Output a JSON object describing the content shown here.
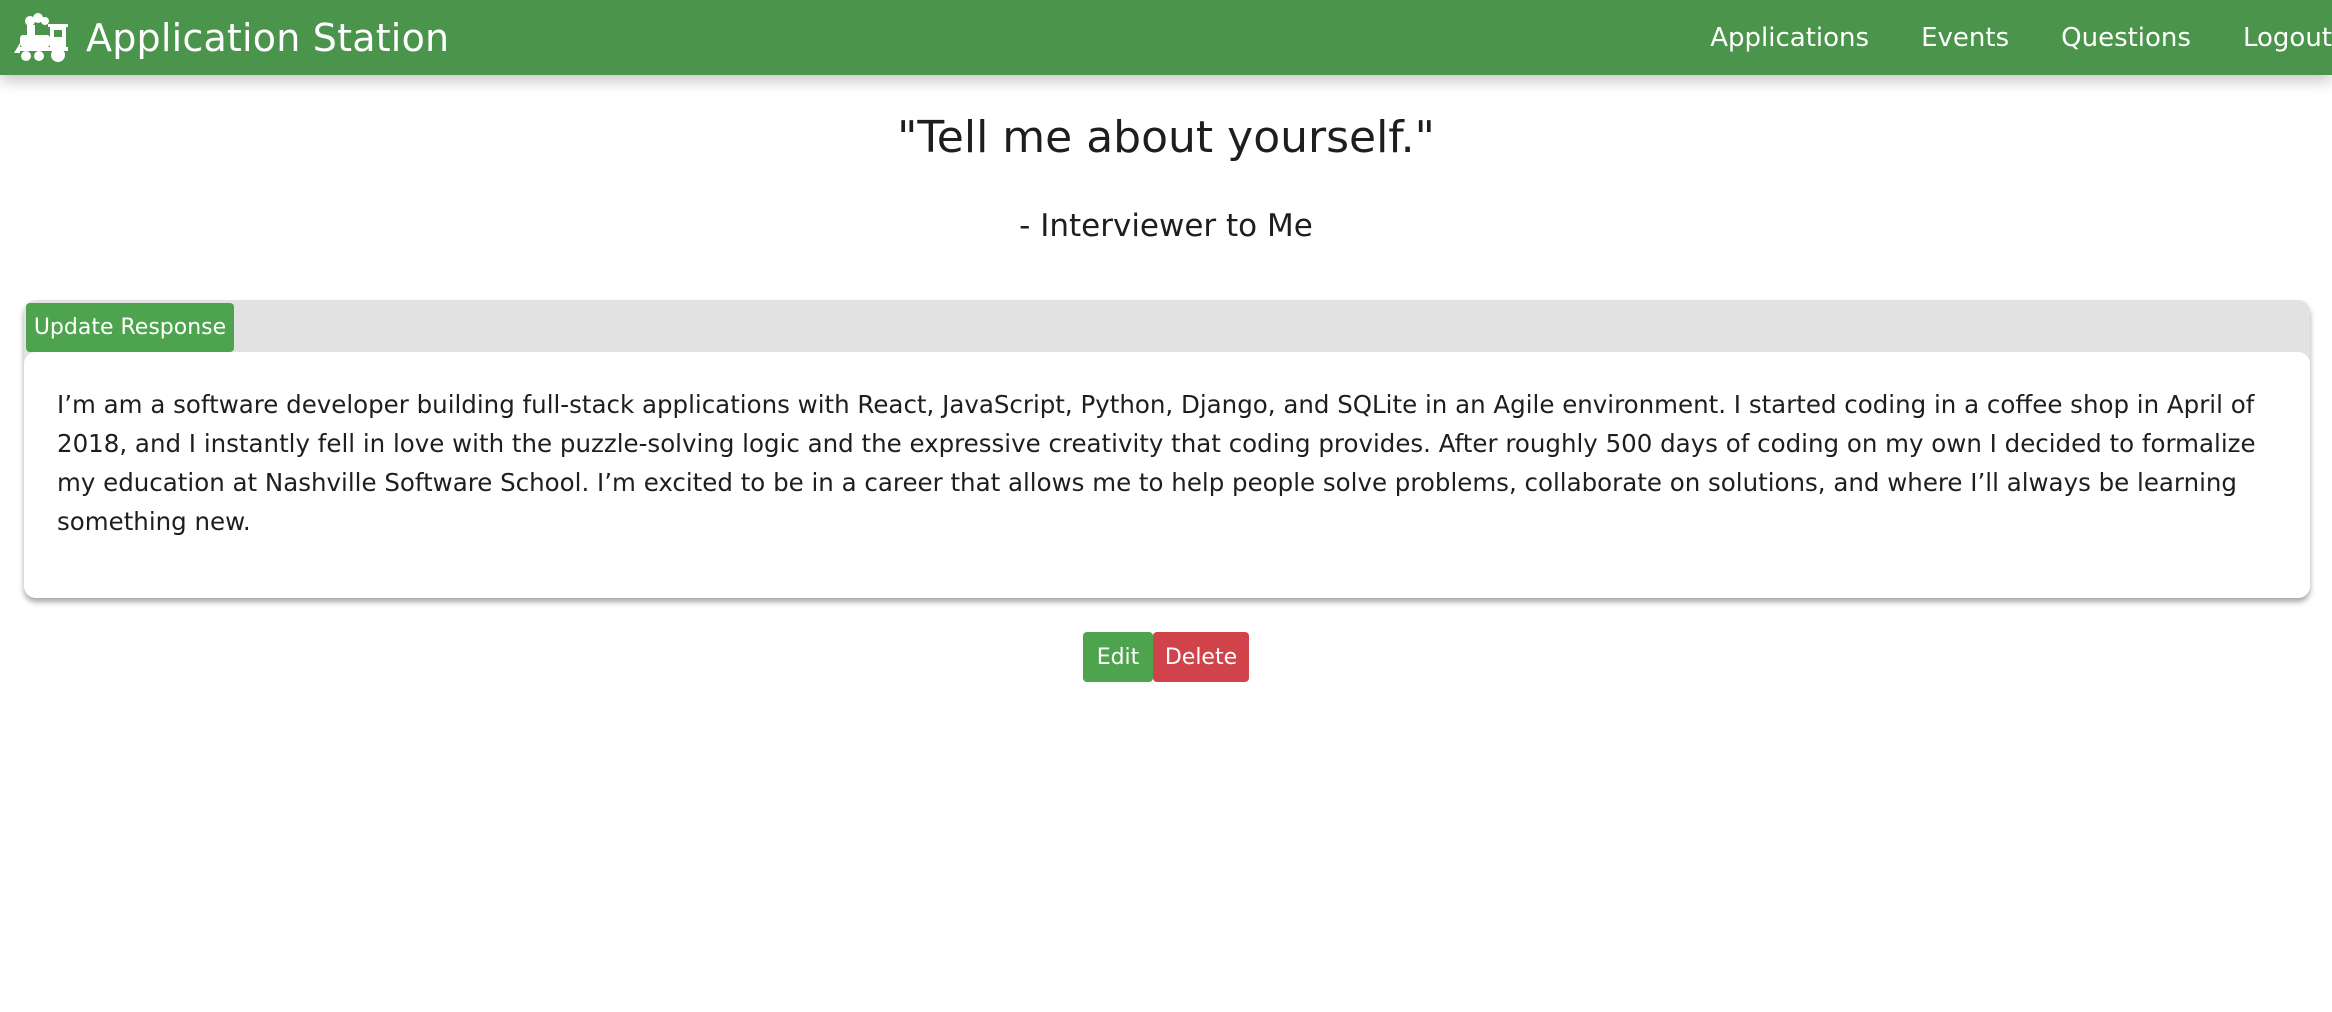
{
  "colors": {
    "navbar": "#4b944b",
    "primary_button": "#4ea44e",
    "danger_button": "#d0434b",
    "panel": "#e2e2e2",
    "text": "#1e1e1e"
  },
  "navbar": {
    "brand_icon": "locomotive-icon",
    "brand_title": "Application Station",
    "links": [
      {
        "label": "Applications"
      },
      {
        "label": "Events"
      },
      {
        "label": "Questions"
      },
      {
        "label": "Logout"
      }
    ]
  },
  "question": {
    "text": "\"Tell me about yourself.\"",
    "attribution": "- Interviewer to Me"
  },
  "response": {
    "update_label": "Update Response",
    "text": "I’m am a software developer building full-stack applications with React, JavaScript, Python, Django, and SQLite in an Agile environment. I started coding in a coffee shop in April of 2018, and I instantly fell in love with the puzzle-solving logic and the expressive creativity that coding provides. After roughly 500 days of coding on my own I decided to formalize my education at Nashville Software School. I’m excited to be in a career that allows me to help people solve problems, collaborate on solutions, and where I’ll always be learning something new."
  },
  "actions": {
    "edit_label": "Edit",
    "delete_label": "Delete"
  }
}
